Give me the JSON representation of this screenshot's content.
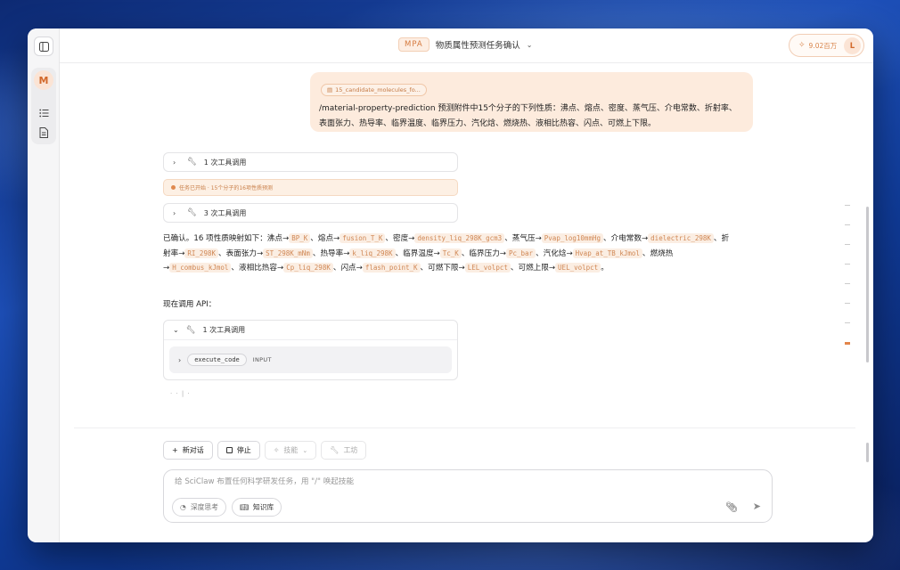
{
  "header": {
    "badge": "MPA",
    "title": "物质属性预测任务确认",
    "credits": "9.02百万",
    "user_initial": "L"
  },
  "sidebar": {
    "avatar_initial": "M"
  },
  "chat": {
    "attachment_name": "15_candidate_molecules_fo...",
    "user_message": "/material-property-prediction 预测附件中15个分子的下列性质：沸点、熔点、密度、蒸气压、介电常数、折射率、表面张力、热导率、临界温度、临界压力、汽化焓、燃烧热、液相比热容、闪点、可燃上下限。",
    "tool_call_1": "1 次工具调用",
    "task_banner": "任务已开始 · 15个分子的16项性质预测",
    "tool_call_2": "3 次工具调用",
    "assistant": {
      "intro": "已确认。16 项性质映射如下：沸点→",
      "map": [
        {
          "key": "BP_K",
          "sep": "、熔点→"
        },
        {
          "key": "fusion_T_K",
          "sep": "、密度→"
        },
        {
          "key": "density_liq_298K_gcm3",
          "sep": "、蒸气压→"
        },
        {
          "key": "Pvap_log10mmHg",
          "sep": "、介电常数→"
        },
        {
          "key": "dielectric_298K",
          "sep": "、折射率→"
        },
        {
          "key": "RI_298K",
          "sep": "、表面张力→"
        },
        {
          "key": "ST_298K_mNm",
          "sep": "、热导率→"
        },
        {
          "key": "k_liq_298K",
          "sep": "、临界温度→"
        },
        {
          "key": "Tc_K",
          "sep": "、临界压力→"
        },
        {
          "key": "Pc_bar",
          "sep": "、汽化焓→"
        },
        {
          "key": "Hvap_at_TB_kJmol",
          "sep": "、燃烧热→"
        },
        {
          "key": "H_combus_kJmol",
          "sep": "、液相比热容→"
        },
        {
          "key": "Cp_liq_298K",
          "sep": "、闪点→"
        },
        {
          "key": "flash_point_K",
          "sep": "、可燃下限→"
        },
        {
          "key": "LEL_volpct",
          "sep": "、可燃上限→"
        },
        {
          "key": "UEL_volpct",
          "sep": "。"
        }
      ],
      "api_label": "现在调用 API：",
      "tool_call_3": "1 次工具调用",
      "exec_name": "execute_code",
      "exec_input": "INPUT",
      "typing": "· · | ·"
    }
  },
  "actions": {
    "new_chat": "新对话",
    "stop": "停止",
    "skills": "技能",
    "workshop": "工坊"
  },
  "composer": {
    "placeholder": "给 SciClaw 布置任何科学研发任务，用 \"/\" 唤起技能",
    "deep_think": "深度思考",
    "knowledge_base": "知识库"
  },
  "colors": {
    "accent": "#d8844a",
    "accent_bg": "#fdebdd"
  }
}
